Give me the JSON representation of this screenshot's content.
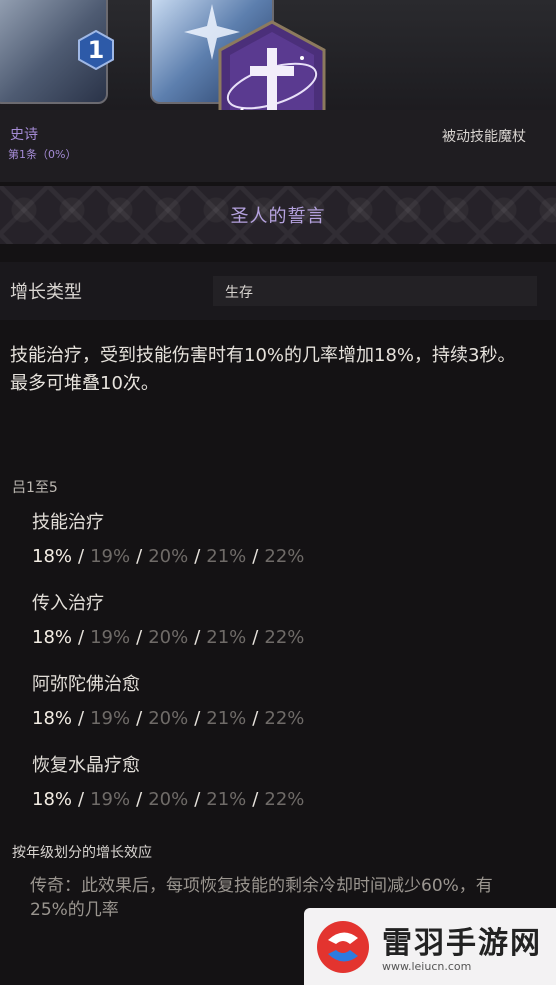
{
  "skill_tiles": [
    {
      "name": "left-skill-tile",
      "level": "1"
    },
    {
      "name": "middle-skill-tile"
    }
  ],
  "gem": {
    "level": "1"
  },
  "header": {
    "rarity": "史诗",
    "rarity_sub": "第1条（0%）",
    "item_type": "被动技能魔杖"
  },
  "title": "圣人的誓言",
  "growth": {
    "label": "增长类型",
    "value": "生存"
  },
  "description": "技能治疗，受到技能伤害时有10%的几率增加18%，持续3秒。最多可堆叠10次。",
  "range_label": "吕1至5",
  "stats": [
    {
      "name": "技能治疗",
      "values": [
        "18%",
        "19%",
        "20%",
        "21%",
        "22%"
      ]
    },
    {
      "name": "传入治疗",
      "values": [
        "18%",
        "19%",
        "20%",
        "21%",
        "22%"
      ]
    },
    {
      "name": "阿弥陀佛治愈",
      "values": [
        "18%",
        "19%",
        "20%",
        "21%",
        "22%"
      ]
    },
    {
      "name": "恢复水晶疗愈",
      "values": [
        "18%",
        "19%",
        "20%",
        "21%",
        "22%"
      ]
    }
  ],
  "separator": "/",
  "growth_effect_label": "按年级划分的增长效应",
  "legendary_text": "传奇：此效果后，每项恢复技能的剩余冷却时间减少60%，有25%的几率",
  "watermark": {
    "title": "雷羽手游网",
    "url": "www.leiucn.com"
  },
  "colors": {
    "epic_purple": "#a58cd6",
    "title_lavender": "#b6a3e0",
    "active_value": "#f3ede4",
    "inactive_value": "#6f6b68"
  }
}
